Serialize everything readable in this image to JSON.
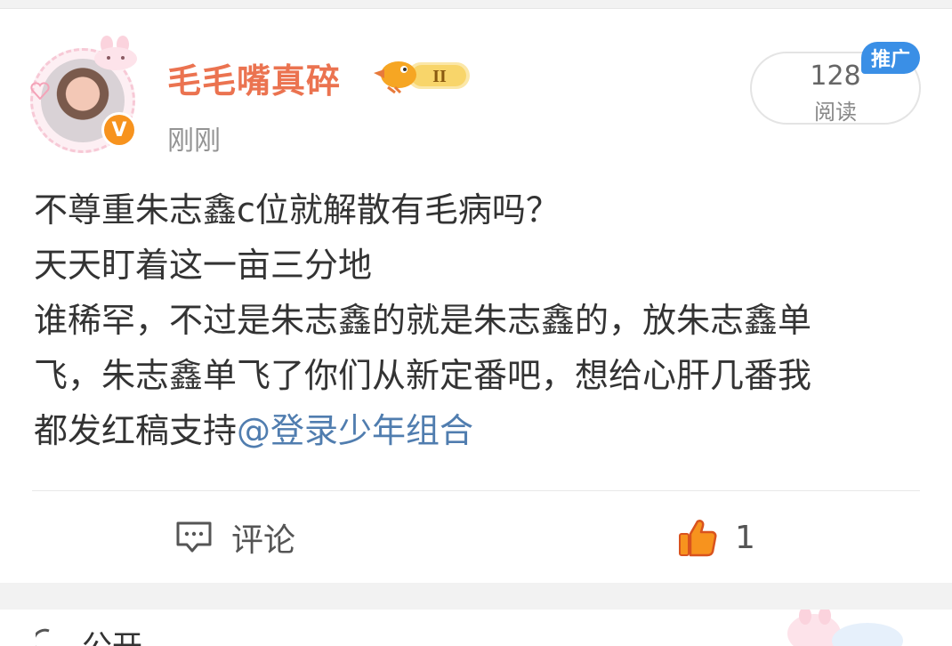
{
  "post": {
    "author": "毛毛嘴真碎",
    "level_badge": "II",
    "timestamp": "刚刚",
    "read_count": "128",
    "read_label": "阅读",
    "promo_tag": "推广",
    "body_lines": [
      "不尊重朱志鑫c位就解散有毛病吗？",
      "天天盯着这一亩三分地",
      "谁稀罕，不过是朱志鑫的就是朱志鑫的，放朱志鑫单",
      "飞，朱志鑫单飞了你们从新定番吧，想给心肝几番我"
    ],
    "last_line_text": "都发红稿支持",
    "mention": "@登录少年组合"
  },
  "actions": {
    "comment_label": "评论",
    "like_count": "1"
  },
  "next_card": {
    "label": "公开"
  },
  "colors": {
    "username": "#eb7350",
    "mention": "#507daf",
    "promo": "#3a8fe6",
    "like": "#f7931e"
  }
}
